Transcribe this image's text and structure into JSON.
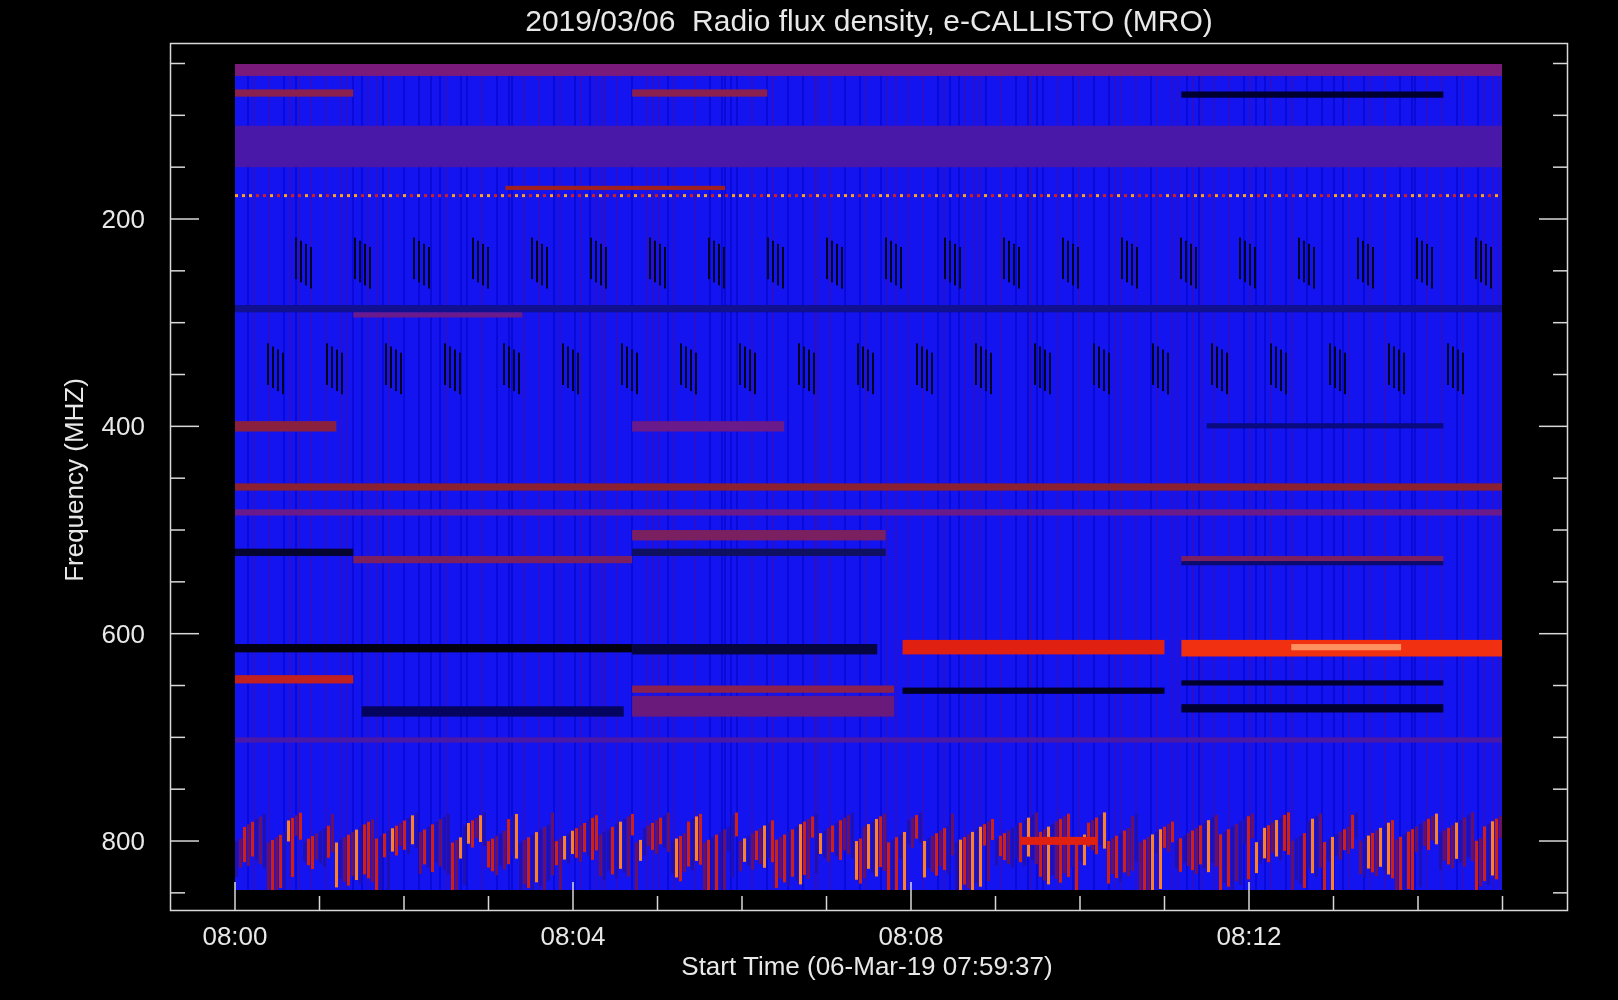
{
  "title": "2019/03/06  Radio flux density, e-CALLISTO (MRO)",
  "x_axis": {
    "label": "Start Time (06-Mar-19 07:59:37)",
    "ticks": [
      "08:00",
      "08:04",
      "08:08",
      "08:12"
    ]
  },
  "y_axis": {
    "label": "Frequency (MHZ)",
    "ticks": [
      "200",
      "400",
      "600",
      "800"
    ]
  }
}
